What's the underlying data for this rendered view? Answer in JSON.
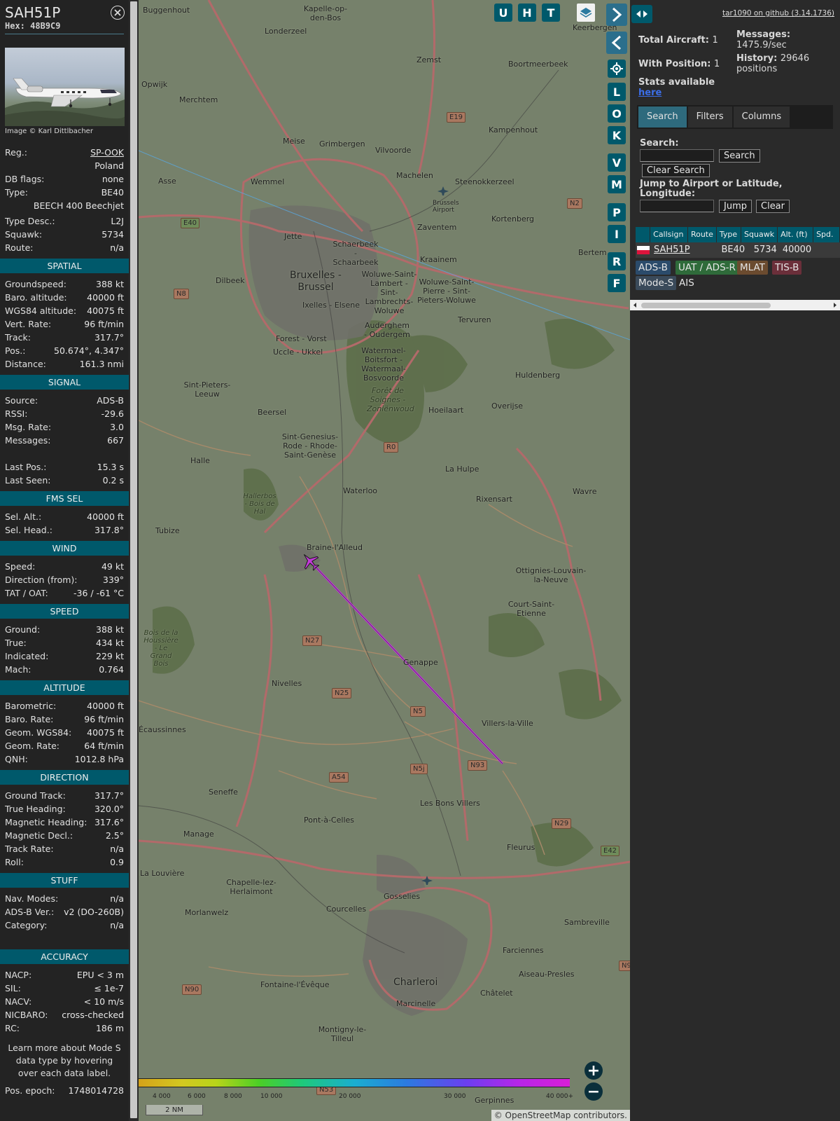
{
  "aircraft": {
    "callsign": "SAH51P",
    "hex_label": "Hex:",
    "hex": "48B9C9",
    "image_credit": "Image © Karl Dittlbacher",
    "registration_label": "Reg.:",
    "registration": "SP-OOK",
    "country": "Poland",
    "db_flags_label": "DB flags:",
    "db_flags": "none",
    "type_label": "Type:",
    "type": "BE40",
    "type_name": "BEECH 400 Beechjet",
    "type_desc_label": "Type Desc.:",
    "type_desc": "L2J",
    "squawk_label": "Squawk:",
    "squawk": "5734",
    "route_label": "Route:",
    "route": "n/a"
  },
  "sections": [
    {
      "title": "SPATIAL",
      "rows": [
        [
          "Groundspeed:",
          "388 kt"
        ],
        [
          "Baro. altitude:",
          "40000 ft"
        ],
        [
          "WGS84 altitude:",
          "40075 ft"
        ],
        [
          "Vert. Rate:",
          "96 ft/min"
        ],
        [
          "Track:",
          "317.7°"
        ],
        [
          "Pos.:",
          "50.674°, 4.347°"
        ],
        [
          "Distance:",
          "161.3 nmi"
        ]
      ]
    },
    {
      "title": "SIGNAL",
      "rows": [
        [
          "Source:",
          "ADS-B"
        ],
        [
          "RSSI:",
          "-29.6"
        ],
        [
          "Msg. Rate:",
          "3.0"
        ],
        [
          "Messages:",
          "667"
        ],
        [
          "",
          ""
        ],
        [
          "Last Pos.:",
          "15.3 s"
        ],
        [
          "Last Seen:",
          "0.2 s"
        ]
      ]
    },
    {
      "title": "FMS SEL",
      "rows": [
        [
          "Sel. Alt.:",
          "40000 ft"
        ],
        [
          "Sel. Head.:",
          "317.8°"
        ]
      ]
    },
    {
      "title": "WIND",
      "rows": [
        [
          "Speed:",
          "49 kt"
        ],
        [
          "Direction (from):",
          "339°"
        ],
        [
          "TAT / OAT:",
          "-36 / -61 °C"
        ]
      ]
    },
    {
      "title": "SPEED",
      "rows": [
        [
          "Ground:",
          "388 kt"
        ],
        [
          "True:",
          "434 kt"
        ],
        [
          "Indicated:",
          "229 kt"
        ],
        [
          "Mach:",
          "0.764"
        ]
      ]
    },
    {
      "title": "ALTITUDE",
      "rows": [
        [
          "Barometric:",
          "40000 ft"
        ],
        [
          "Baro. Rate:",
          "96 ft/min"
        ],
        [
          "Geom. WGS84:",
          "40075 ft"
        ],
        [
          "Geom. Rate:",
          "64 ft/min"
        ],
        [
          "QNH:",
          "1012.8 hPa"
        ]
      ]
    },
    {
      "title": "DIRECTION",
      "rows": [
        [
          "Ground Track:",
          "317.7°"
        ],
        [
          "True Heading:",
          "320.0°"
        ],
        [
          "Magnetic Heading:",
          "317.6°"
        ],
        [
          "Magnetic Decl.:",
          "2.5°"
        ],
        [
          "Track Rate:",
          "n/a"
        ],
        [
          "Roll:",
          "0.9"
        ]
      ]
    },
    {
      "title": "STUFF",
      "rows": [
        [
          "Nav. Modes:",
          "n/a"
        ],
        [
          "ADS-B Ver.:",
          "v2 (DO-260B)"
        ],
        [
          "Category:",
          "n/a"
        ],
        [
          "",
          ""
        ]
      ]
    },
    {
      "title": "ACCURACY",
      "rows": [
        [
          "NACP:",
          "EPU < 3 m"
        ],
        [
          "SIL:",
          "≤ 1e-7"
        ],
        [
          "NACV:",
          "< 10 m/s"
        ],
        [
          "NICBARO:",
          "cross-checked"
        ],
        [
          "RC:",
          "186 m"
        ]
      ]
    }
  ],
  "learn_more": "Learn more about Mode S data type by hovering over each data label.",
  "pos_epoch_label": "Pos. epoch:",
  "pos_epoch": "1748014728",
  "map": {
    "buttons_top": [
      "U",
      "H",
      "T"
    ],
    "side_buttons": [
      "L",
      "O",
      "K",
      "V",
      "M",
      "P",
      "I",
      "R",
      "F"
    ],
    "places": [
      "Buggenhout",
      "Kapelle-op-den-Bos",
      "Keerbergen",
      "Londerzeel",
      "Zemst",
      "Boortmeerbeek",
      "Opwijk",
      "Merchtem",
      "Meise",
      "Grimbergen",
      "Vilvoorde",
      "Kampenhout",
      "Asse",
      "Wemmel",
      "Machelen",
      "Steenokkerzeel",
      "Brussels Airport",
      "Kortenberg",
      "Zaventem",
      "Jette",
      "Schaerbeek - Schaarbeek",
      "Kraainem",
      "Bertem",
      "Dilbeek",
      "Bruxelles - Brussel",
      "Woluwe-Saint-Lambert - Sint-Lambrechts-Woluwe",
      "Woluwe-Saint-Pierre - Sint-Pieters-Woluwe",
      "Ixelles - Elsene",
      "Tervuren",
      "Forest - Vorst",
      "Auderghem - Oudergem",
      "Uccle - Ukkel",
      "Watermael-Boitsfort - Watermaal-Bosvoorde",
      "Huldenberg",
      "Sint-Pieters-Leeuw",
      "Forêt de Soignes - Zoniënwoud",
      "Hoeilaart",
      "Overijse",
      "Beersel",
      "Sint-Genesius-Rode - Rhode-Saint-Genèse",
      "La Hulpe",
      "Halle",
      "Waterloo",
      "Rixensart",
      "Wavre",
      "Hallerbos - Bois de Hal",
      "Tubize",
      "Braine-l'Alleud",
      "Ottignies-Louvain-la-Neuve",
      "Court-Saint-Etienne",
      "Bois de la Houssière - Le Grand Bois",
      "Genappe",
      "Nivelles",
      "Villers-la-Ville",
      "Seneffe",
      "Les Bons Villers",
      "Pont-à-Celles",
      "Manage",
      "Fleurus",
      "Chapelle-lez-Herlaimont",
      "La Louvière",
      "Morlanwelz",
      "Courcelles",
      "Gosselies",
      "Sambreville",
      "Farciennes",
      "Aiseau-Presles",
      "Charleroi",
      "Fontaine-l'Évêque",
      "Châtelet",
      "Marcinelle",
      "Montigny-le-Tilleul",
      "Gerpinnes",
      "Écaussinnes"
    ],
    "roads": [
      "E19",
      "E40",
      "N2",
      "N8",
      "R0",
      "N27",
      "N25",
      "N5",
      "N5j",
      "N93",
      "A54",
      "N29",
      "E42",
      "N90",
      "N53",
      "N9"
    ],
    "altitude_ticks": [
      "4 000",
      "6 000",
      "8 000",
      "10 000",
      "20 000",
      "30 000",
      "40 000+"
    ],
    "scale": "2 NM",
    "attribution": "© OpenStreetMap contributors."
  },
  "right": {
    "github": "tar1090 on github (3.14.1736)",
    "total_aircraft_label": "Total Aircraft:",
    "total_aircraft": "1",
    "messages_label": "Messages:",
    "messages": "1475.9/sec",
    "with_position_label": "With Position:",
    "with_position": "1",
    "history_label": "History:",
    "history": "29646 positions",
    "stats_label": "Stats available",
    "stats_link": "here",
    "tabs": [
      "Search",
      "Filters",
      "Columns"
    ],
    "search_label": "Search:",
    "search_button": "Search",
    "clear_search_button": "Clear Search",
    "jump_label": "Jump to Airport or Latitude, Longitude:",
    "jump_button": "Jump",
    "clear_button": "Clear",
    "table_headers": [
      "",
      "Callsign",
      "Route",
      "Type",
      "Squawk",
      "Alt. (ft)",
      "Spd."
    ],
    "table_row": {
      "callsign": "SAH51P",
      "route": "",
      "type": "BE40",
      "squawk": "5734",
      "alt": "40000"
    },
    "sources": [
      {
        "label": "ADS-B",
        "color": "#2b4b6b"
      },
      {
        "label": "UAT / ADS-R",
        "color": "#2f6b3a"
      },
      {
        "label": "MLAT",
        "color": "#6b4b2f"
      },
      {
        "label": "TIS-B",
        "color": "#6b2f3a"
      },
      {
        "label": "Mode-S",
        "color": "#3a4a5a"
      },
      {
        "label": "AIS",
        "color": "#2a2a2a"
      }
    ]
  }
}
